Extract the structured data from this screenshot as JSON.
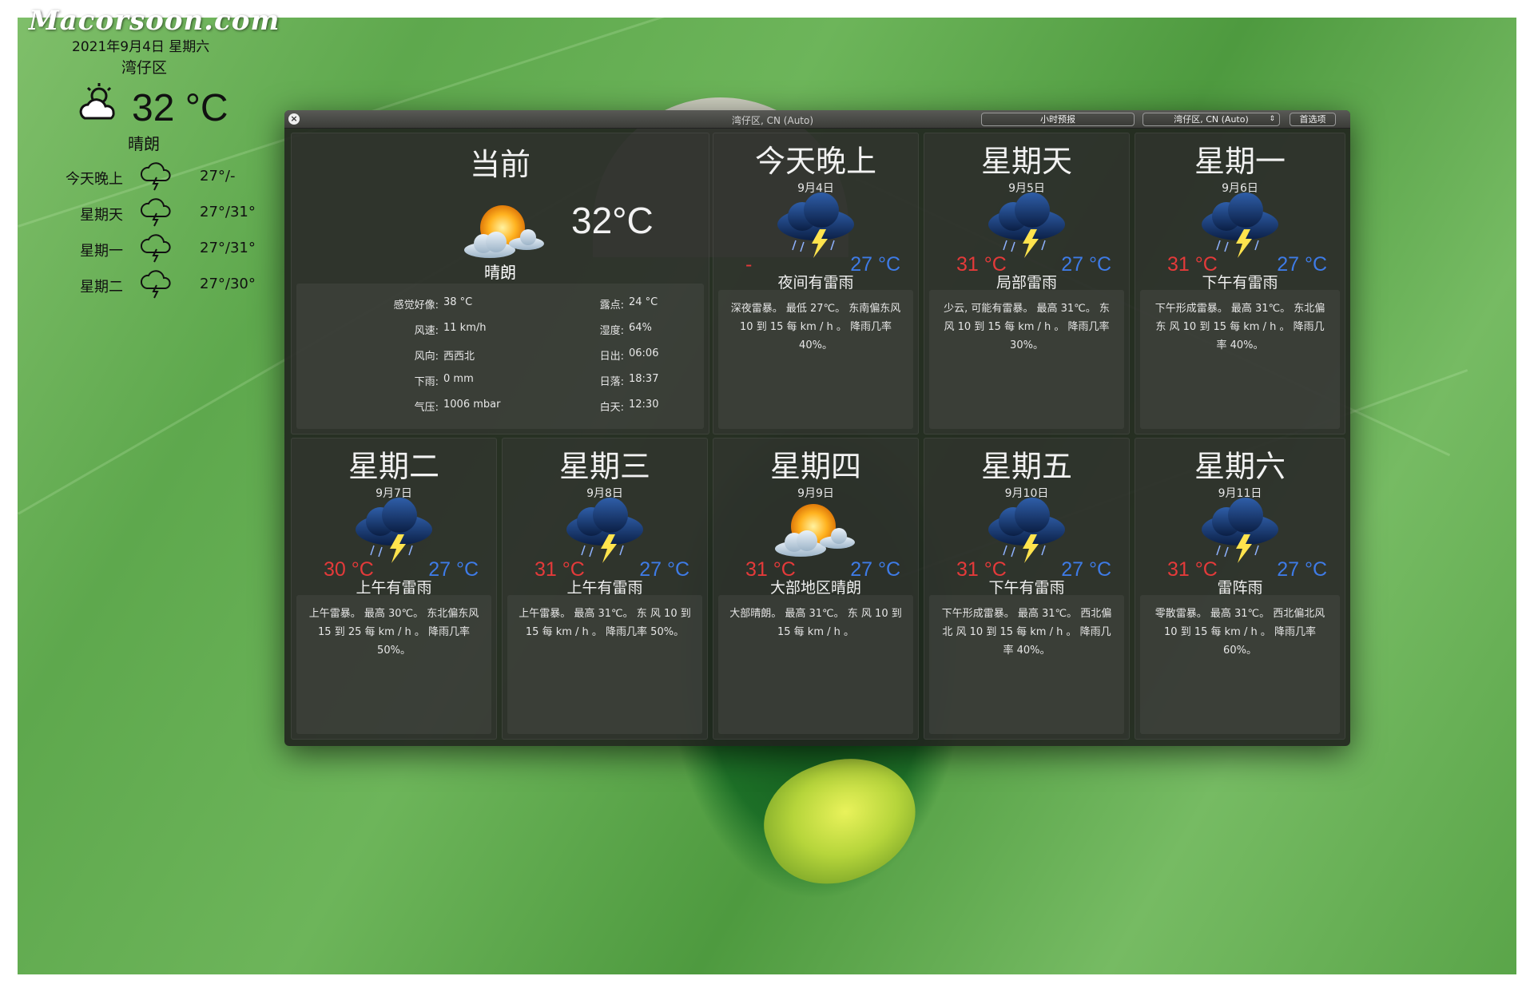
{
  "watermark": "Macorsoon.com",
  "widget": {
    "date": "2021年9月4日  星期六",
    "location": "湾仔区",
    "temp": "32 °C",
    "condition": "晴朗",
    "forecast": [
      {
        "day": "今天晚上",
        "range": "27°/-",
        "icon": "thunderstorm-icon"
      },
      {
        "day": "星期天",
        "range": "27°/31°",
        "icon": "thunderstorm-icon"
      },
      {
        "day": "星期一",
        "range": "27°/31°",
        "icon": "thunderstorm-icon"
      },
      {
        "day": "星期二",
        "range": "27°/30°",
        "icon": "thunderstorm-icon"
      }
    ]
  },
  "window": {
    "title": "湾仔区, CN (Auto)",
    "hourly_button": "小时预报",
    "location_select": "湾仔区, CN (Auto)",
    "prefs_button": "首选项",
    "close_symbol": "×"
  },
  "current": {
    "title": "当前",
    "temp": "32°C",
    "condition": "晴朗",
    "icon": "partly-sunny-icon",
    "details_left": [
      {
        "label": "感觉好像:",
        "value": "38 °C"
      },
      {
        "label": "风速:",
        "value": "11 km/h"
      },
      {
        "label": "风向:",
        "value": "西西北"
      },
      {
        "label": "下雨:",
        "value": "0 mm"
      },
      {
        "label": "气压:",
        "value": "1006 mbar"
      }
    ],
    "details_right": [
      {
        "label": "露点:",
        "value": "24 °C"
      },
      {
        "label": "湿度:",
        "value": "64%"
      },
      {
        "label": "日出:",
        "value": "06:06"
      },
      {
        "label": "日落:",
        "value": "18:37"
      },
      {
        "label": "白天:",
        "value": "12:30"
      }
    ]
  },
  "forecast": [
    {
      "title": "今天晚上",
      "date": "9月4日",
      "hi": "-",
      "lo": "27 °C",
      "condition": "夜间有雷雨",
      "icon": "thunderstorm-icon",
      "desc": "深夜雷暴。 最低 27℃。 东南偏东风 10 到 15 每 km / h 。 降雨几率 40%。"
    },
    {
      "title": "星期天",
      "date": "9月5日",
      "hi": "31 °C",
      "lo": "27 °C",
      "condition": "局部雷雨",
      "icon": "thunderstorm-icon",
      "desc": "少云, 可能有雷暴。 最高 31℃。 东风 10 到 15 每 km / h 。 降雨几率 30%。"
    },
    {
      "title": "星期一",
      "date": "9月6日",
      "hi": "31 °C",
      "lo": "27 °C",
      "condition": "下午有雷雨",
      "icon": "thunderstorm-icon",
      "desc": "下午形成雷暴。 最高 31℃。 东北偏东 风 10 到 15 每 km / h 。 降雨几率 40%。"
    },
    {
      "title": "星期二",
      "date": "9月7日",
      "hi": "30 °C",
      "lo": "27 °C",
      "condition": "上午有雷雨",
      "icon": "thunderstorm-icon",
      "desc": "上午雷暴。 最高 30℃。 东北偏东风 15 到 25 每 km / h 。 降雨几率 50%。"
    },
    {
      "title": "星期三",
      "date": "9月8日",
      "hi": "31 °C",
      "lo": "27 °C",
      "condition": "上午有雷雨",
      "icon": "thunderstorm-icon",
      "desc": "上午雷暴。 最高 31℃。 东 风 10 到 15 每 km / h 。 降雨几率 50%。"
    },
    {
      "title": "星期四",
      "date": "9月9日",
      "hi": "31 °C",
      "lo": "27 °C",
      "condition": "大部地区晴朗",
      "icon": "partly-sunny-icon",
      "desc": "大部晴朗。 最高 31℃。 东 风 10 到 15 每 km / h 。"
    },
    {
      "title": "星期五",
      "date": "9月10日",
      "hi": "31 °C",
      "lo": "27 °C",
      "condition": "下午有雷雨",
      "icon": "thunderstorm-icon",
      "desc": "下午形成雷暴。 最高 31℃。 西北偏北 风 10 到 15 每 km / h 。 降雨几率 40%。"
    },
    {
      "title": "星期六",
      "date": "9月11日",
      "hi": "31 °C",
      "lo": "27 °C",
      "condition": "雷阵雨",
      "icon": "thunderstorm-icon",
      "desc": "零散雷暴。 最高 31℃。 西北偏北风 10 到 15 每 km / h 。 降雨几率 60%。"
    }
  ],
  "colors": {
    "hi": "#e43a3a",
    "lo": "#3e7be6",
    "sun": "#ffb21f",
    "storm_cloud": "#14336a"
  }
}
